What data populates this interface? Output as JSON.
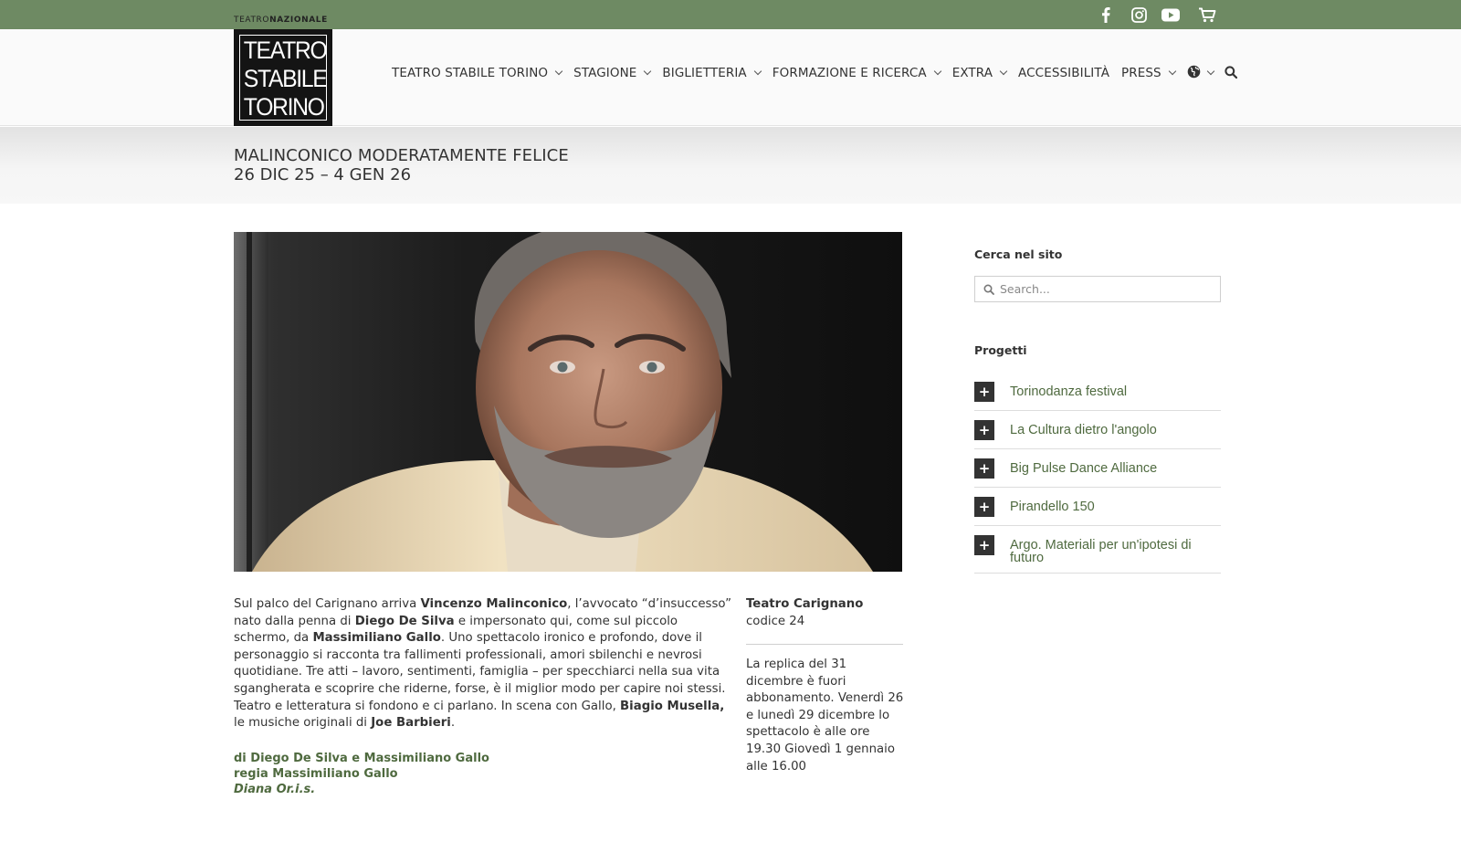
{
  "topbar": {
    "icons": [
      "facebook-icon",
      "instagram-icon",
      "youtube-icon",
      "cart-icon"
    ]
  },
  "logo": {
    "tagline_a": "TEATRO",
    "tagline_b": "NAZIONALE",
    "line1": "TEATRO",
    "line2": "STABILE",
    "line3": "TORINO"
  },
  "nav": {
    "items": [
      {
        "label": "TEATRO STABILE TORINO",
        "has_dropdown": true
      },
      {
        "label": "STAGIONE",
        "has_dropdown": true
      },
      {
        "label": "BIGLIETTERIA",
        "has_dropdown": true
      },
      {
        "label": "FORMAZIONE E RICERCA",
        "has_dropdown": true
      },
      {
        "label": "EXTRA",
        "has_dropdown": true
      },
      {
        "label": "ACCESSIBILITÀ",
        "has_dropdown": false
      },
      {
        "label": "PRESS",
        "has_dropdown": true
      }
    ],
    "language_icon": "globe-icon",
    "search_icon": "search-icon"
  },
  "page": {
    "title": "MALINCONICO MODERATAMENTE FELICE",
    "dates": "26 DIC 25 – 4 GEN 26"
  },
  "body": {
    "p1_a": "Sul palco del Carignano arriva ",
    "p1_b": "Vincenzo Malinconico",
    "p1_c": ", l’avvocato “d’insuccesso” nato dalla penna di ",
    "p1_d": "Diego De Silva",
    "p1_e": " e impersonato qui, come sul piccolo schermo, da ",
    "p1_f": "Massimiliano Gallo",
    "p1_g": ". Uno spettacolo ironico e profondo, dove il personaggio si racconta tra fallimenti professionali, amori sbilenchi e nevrosi quotidiane. Tre atti – lavoro, sentimenti, famiglia – per specchiarci nella sua vita sgangherata e scoprire che riderne, forse, è il miglior modo per capire noi stessi. Teatro e letteratura si fondono e ci parlano. In scena con Gallo, ",
    "p1_h": "Biagio Musella,",
    "p1_i": " le musiche originali di ",
    "p1_j": "Joe Barbieri",
    "p1_k": ".",
    "credit1": "di Diego De Silva e Massimiliano Gallo",
    "credit2": "regia Massimiliano Gallo",
    "credit3": "Diana Or.i.s."
  },
  "info": {
    "venue": "Teatro Carignano",
    "code": "codice 24",
    "notes": "La replica del 31 dicembre è fuori abbonamento. Venerdì 26 e lunedì 29 dicembre lo spettacolo è alle ore 19.30 Giovedì 1 gennaio alle 16.00"
  },
  "sidebar": {
    "search_heading": "Cerca nel sito",
    "search_placeholder": "Search...",
    "projects_heading": "Progetti",
    "projects": [
      "Torinodanza festival",
      "La Cultura dietro l'angolo",
      "Big Pulse Dance Alliance",
      "Pirandello 150",
      "Argo. Materiali per un'ipotesi di futuro"
    ]
  }
}
